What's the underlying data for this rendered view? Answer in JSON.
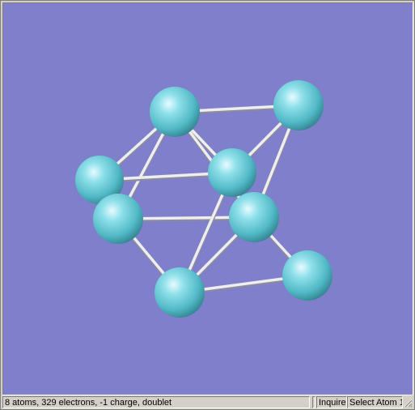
{
  "viewer": {
    "background_color": "#7f7fcc",
    "atom_color": "#5ec8d4",
    "bond_color": "#eeeeee",
    "atoms": [
      {
        "id": "a1"
      },
      {
        "id": "a2"
      },
      {
        "id": "a3"
      },
      {
        "id": "a4"
      },
      {
        "id": "a5"
      },
      {
        "id": "a6"
      },
      {
        "id": "a7"
      },
      {
        "id": "a8"
      }
    ]
  },
  "statusbar": {
    "summary": "8 atoms, 329 electrons, -1 charge, doublet",
    "mode": "Inquire",
    "prompt": "Select Atom 1"
  }
}
